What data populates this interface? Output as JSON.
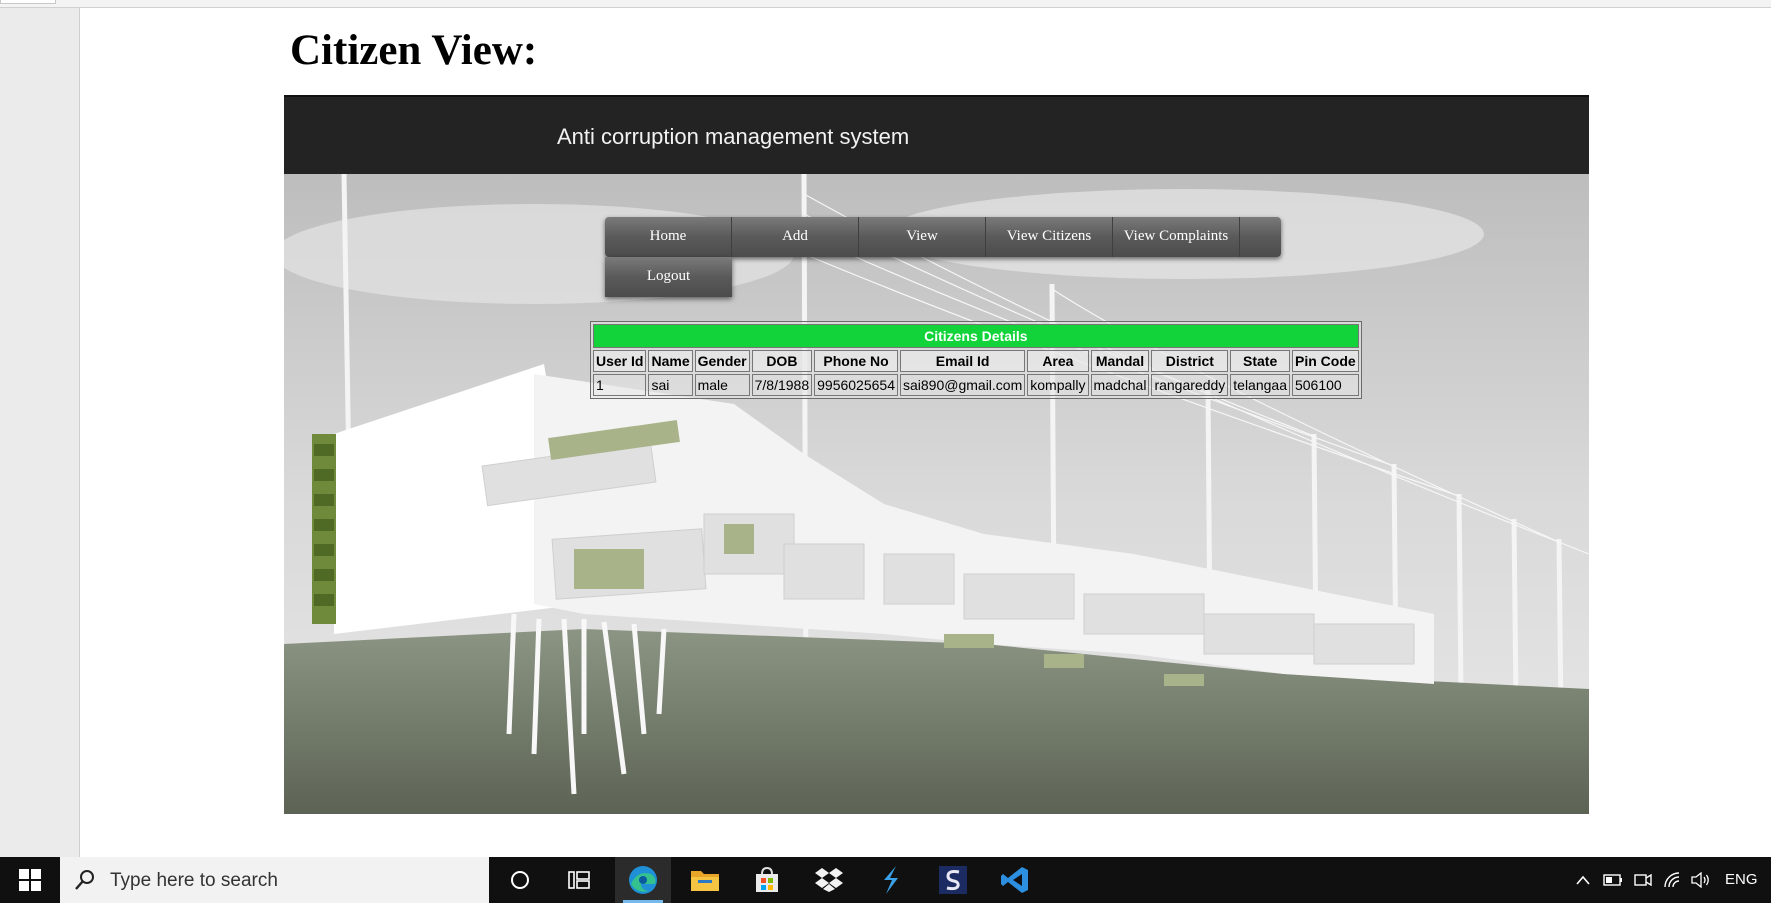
{
  "document": {
    "title": "Citizen View:"
  },
  "site": {
    "title": "Anti corruption management system"
  },
  "nav": {
    "items": [
      "Home",
      "Add",
      "View",
      "View Citizens",
      "View Complaints"
    ],
    "logout": "Logout"
  },
  "table": {
    "caption": "Citizens Details",
    "headers": [
      "User Id",
      "Name",
      "Gender",
      "DOB",
      "Phone No",
      "Email Id",
      "Area",
      "Mandal",
      "District",
      "State",
      "Pin Code"
    ],
    "rows": [
      [
        "1",
        "sai",
        "male",
        "7/8/1988",
        "9956025654",
        "sai890@gmail.com",
        "kompally",
        "madchal",
        "rangareddy",
        "telangaa",
        "506100"
      ]
    ]
  },
  "taskbar": {
    "search_placeholder": "Type here to search",
    "apps": [
      "cortana-icon",
      "task-view-icon",
      "edge-icon",
      "file-explorer-icon",
      "store-icon",
      "dropbox-icon",
      "app-s-blue-icon",
      "app-s-navy-icon",
      "vscode-icon"
    ],
    "language": "ENG"
  },
  "colors": {
    "caption_green": "#12d43a",
    "header_bg": "#232323",
    "taskbar_bg": "#101010"
  }
}
